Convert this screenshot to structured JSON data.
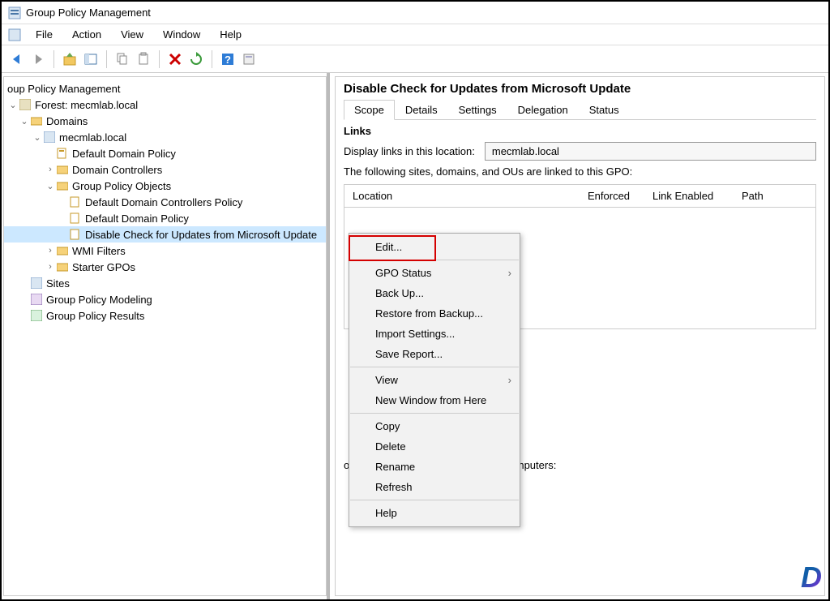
{
  "window": {
    "title": "Group Policy Management"
  },
  "menubar": {
    "file": "File",
    "action": "Action",
    "view": "View",
    "window": "Window",
    "help": "Help"
  },
  "tree": {
    "root": "oup Policy Management",
    "forest": "Forest: mecmlab.local",
    "domains": "Domains",
    "domain": "mecmlab.local",
    "ddp": "Default Domain Policy",
    "dc": "Domain Controllers",
    "gpo": "Group Policy Objects",
    "ddcp": "Default Domain Controllers Policy",
    "ddp2": "Default Domain Policy",
    "disable": "Disable Check for Updates from Microsoft Update",
    "wmi": "WMI Filters",
    "starter": "Starter GPOs",
    "sites": "Sites",
    "modeling": "Group Policy Modeling",
    "results": "Group Policy Results"
  },
  "right": {
    "title": "Disable Check for Updates from Microsoft Update",
    "tabs": {
      "scope": "Scope",
      "details": "Details",
      "settings": "Settings",
      "delegation": "Delegation",
      "status": "Status"
    },
    "links_h": "Links",
    "display_links": "Display links in this location:",
    "location_value": "mecmlab.local",
    "linked_desc": "The following sites, domains, and OUs are linked to this GPO:",
    "cols": {
      "location": "Location",
      "enforced": "Enforced",
      "link_enabled": "Link Enabled",
      "path": "Path"
    },
    "sec_partial": "o the following groups, users, and computers:"
  },
  "context": {
    "edit": "Edit...",
    "gpo_status": "GPO Status",
    "backup": "Back Up...",
    "restore": "Restore from Backup...",
    "import": "Import Settings...",
    "save": "Save Report...",
    "view": "View",
    "new_window": "New Window from Here",
    "copy": "Copy",
    "delete": "Delete",
    "rename": "Rename",
    "refresh": "Refresh",
    "help": "Help"
  }
}
